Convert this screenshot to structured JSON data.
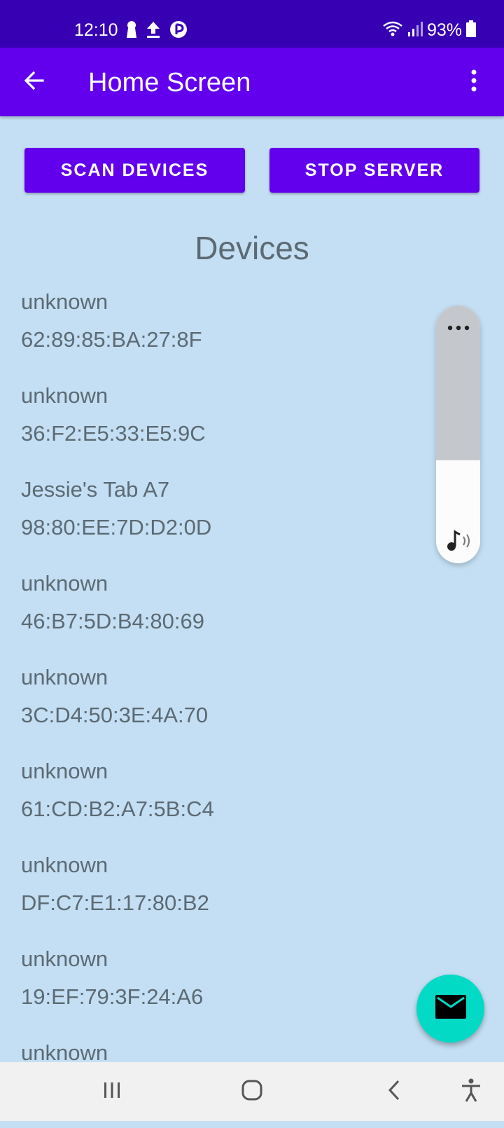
{
  "status_bar": {
    "time": "12:10",
    "battery": "93%",
    "left_icons": [
      "keyhole-icon",
      "upload-icon",
      "app-notification-icon"
    ],
    "right_icons": [
      "wifi-icon",
      "signal-icon",
      "battery-icon"
    ]
  },
  "app_bar": {
    "title": "Home Screen",
    "back_icon": "back-arrow-icon",
    "menu_icon": "more-vert-icon"
  },
  "buttons": {
    "scan": "SCAN DEVICES",
    "stop": "STOP SERVER"
  },
  "section_title": "Devices",
  "devices": [
    {
      "name": "unknown",
      "address": "62:89:85:BA:27:8F"
    },
    {
      "name": "unknown",
      "address": "36:F2:E5:33:E5:9C"
    },
    {
      "name": "Jessie's Tab A7",
      "address": "98:80:EE:7D:D2:0D"
    },
    {
      "name": "unknown",
      "address": "46:B7:5D:B4:80:69"
    },
    {
      "name": "unknown",
      "address": "3C:D4:50:3E:4A:70"
    },
    {
      "name": "unknown",
      "address": "61:CD:B2:A7:5B:C4"
    },
    {
      "name": "unknown",
      "address": "DF:C7:E1:17:80:B2"
    },
    {
      "name": "unknown",
      "address": "19:EF:79:3F:24:A6"
    },
    {
      "name": "unknown",
      "address": ""
    }
  ],
  "volume": {
    "level": 0.4,
    "icons": [
      "more-horiz-icon",
      "media-volume-icon"
    ]
  },
  "fab": {
    "icon": "mail-icon"
  },
  "nav_bar": {
    "icons": [
      "recent-apps-icon",
      "home-icon",
      "back-icon",
      "accessibility-icon"
    ]
  },
  "colors": {
    "status_bar": "#3700b3",
    "primary": "#6200ee",
    "background": "#c4dff4",
    "fab": "#03dac5",
    "text": "#5c6a73"
  }
}
